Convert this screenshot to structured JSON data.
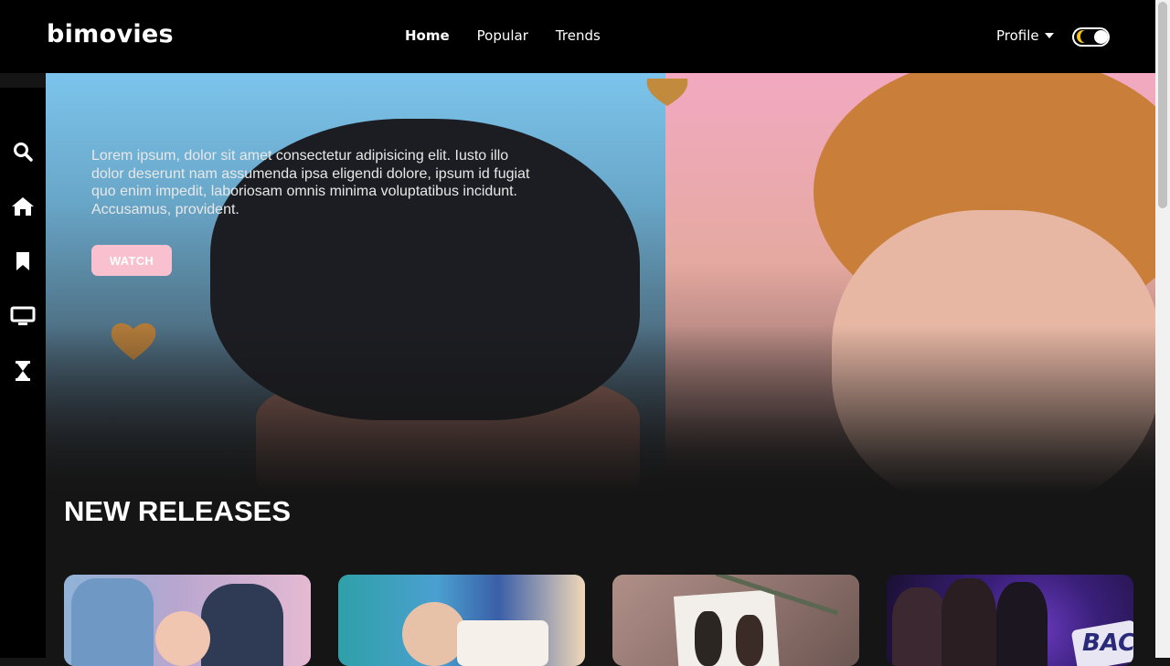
{
  "app": {
    "logo": "bimovies"
  },
  "nav": {
    "items": [
      {
        "label": "Home",
        "active": true
      },
      {
        "label": "Popular",
        "active": false
      },
      {
        "label": "Trends",
        "active": false
      }
    ],
    "profile_label": "Profile",
    "theme_toggle": {
      "state": "dark",
      "accent": "#f2c518"
    }
  },
  "sidebar": {
    "icons": [
      "search-icon",
      "home-icon",
      "bookmark-icon",
      "tv-icon",
      "hourglass-icon"
    ]
  },
  "hero": {
    "description": "Lorem ipsum, dolor sit amet consectetur adipisicing elit. Iusto illo dolor deserunt nam assumenda ipsa eligendi dolore, ipsum id fugiat quo enim impedit, laboriosam omnis minima voluptatibus incidunt. Accusamus, provident.",
    "watch_label": "WATCH",
    "button_color": "#f9c1cf"
  },
  "releases": {
    "title": "NEW RELEASES",
    "cards": [
      {
        "poster": "poster-1"
      },
      {
        "poster": "poster-2"
      },
      {
        "poster": "poster-3"
      },
      {
        "poster": "poster-4",
        "poster_text": "BAC"
      }
    ]
  },
  "colors": {
    "background": "#151515",
    "navbar": "#000000",
    "text": "#ffffff"
  }
}
